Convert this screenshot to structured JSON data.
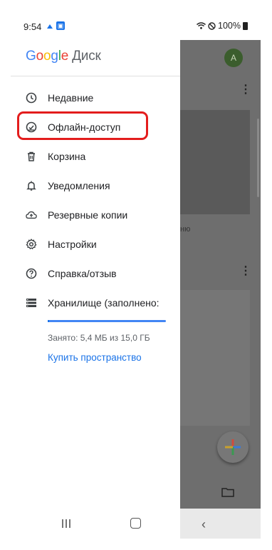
{
  "status_bar": {
    "time": "9:54",
    "battery": "100%"
  },
  "drawer": {
    "logo": {
      "google": [
        "G",
        "o",
        "o",
        "g",
        "l",
        "e"
      ],
      "product": "Диск"
    },
    "items": [
      {
        "label": "Недавние",
        "icon": "clock-icon"
      },
      {
        "label": "Офлайн-доступ",
        "icon": "offline-check-icon",
        "highlighted": true
      },
      {
        "label": "Корзина",
        "icon": "trash-icon"
      },
      {
        "label": "Уведомления",
        "icon": "bell-icon"
      },
      {
        "label": "Резервные копии",
        "icon": "cloud-upload-icon"
      },
      {
        "label": "Настройки",
        "icon": "gear-icon"
      },
      {
        "label": "Справка/отзыв",
        "icon": "help-icon"
      },
      {
        "label": "Хранилище (заполнено:",
        "icon": "storage-icon"
      }
    ],
    "storage": {
      "used_text": "Занято: 5,4 МБ из 15,0 ГБ",
      "used_fraction": 0.0004,
      "buy_link": "Купить пространство"
    }
  },
  "background_app": {
    "avatar_letter": "A",
    "partial_text": "ню"
  },
  "colors": {
    "accent": "#1a73e8",
    "highlight": "#e31d1d",
    "scrim": "#6e6e6e"
  }
}
